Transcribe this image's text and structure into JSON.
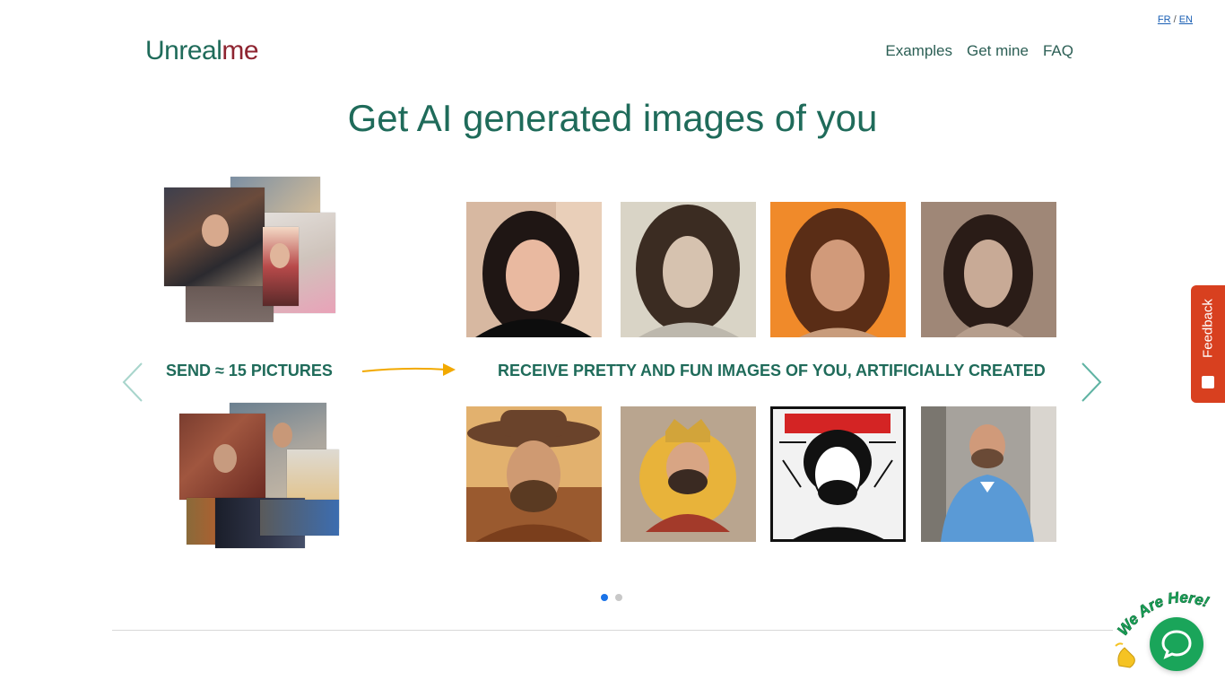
{
  "lang": {
    "fr": "FR",
    "sep": "/",
    "en": "EN"
  },
  "logo": {
    "part1": "Unreal",
    "part2": "me"
  },
  "nav": {
    "items": [
      "Examples",
      "Get mine",
      "FAQ"
    ]
  },
  "hero": {
    "title": "Get AI generated images of you"
  },
  "steps": {
    "send": "SEND ≈ 15 PICTURES",
    "receive": "RECEIVE PRETTY AND FUN IMAGES OF YOU, ARTIFICIALLY CREATED"
  },
  "carousel": {
    "pages": 2,
    "active": 0
  },
  "feedback": {
    "label": "Feedback"
  },
  "chat": {
    "badge": "We Are Here!"
  },
  "colors": {
    "brand_green": "#1f6b5a",
    "brand_red": "#8e2430",
    "feedback": "#d8401f",
    "chat": "#1aa55a",
    "arrow": "#f2a900",
    "dot_active": "#1a73e8"
  },
  "icons": {
    "prev": "chevron-left-icon",
    "next": "chevron-right-icon",
    "arrow": "arrow-right-icon",
    "chat": "chat-bubble-icon",
    "feedback": "feedback-icon",
    "wave": "waving-hand-icon"
  }
}
